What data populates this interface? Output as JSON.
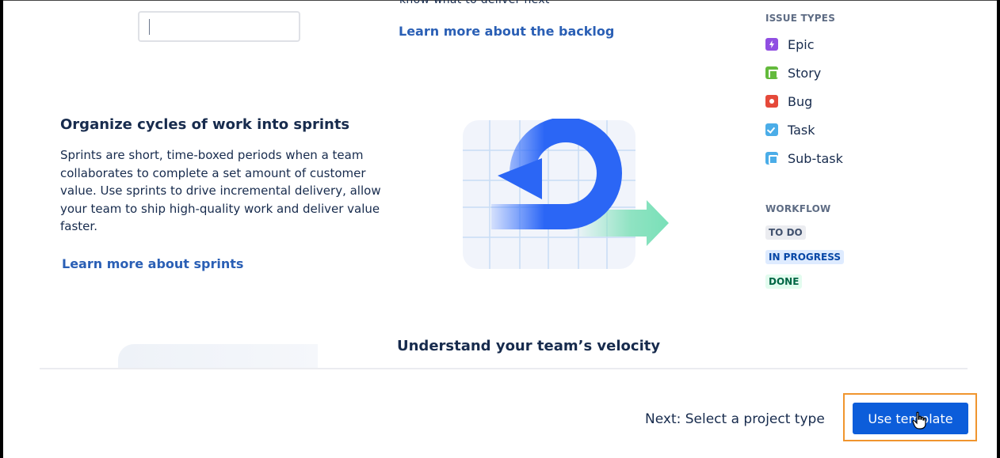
{
  "top": {
    "clipped_text": "know what to deliver next",
    "backlog_link": "Learn more about the backlog"
  },
  "issue_types": {
    "title": "ISSUE TYPES",
    "items": [
      {
        "label": "Epic",
        "icon": "epic-icon",
        "color": "#904ee2"
      },
      {
        "label": "Story",
        "icon": "story-icon",
        "color": "#63ba3c"
      },
      {
        "label": "Bug",
        "icon": "bug-icon",
        "color": "#e5493a"
      },
      {
        "label": "Task",
        "icon": "task-icon",
        "color": "#4bade8"
      },
      {
        "label": "Sub-task",
        "icon": "subtask-icon",
        "color": "#4bade8"
      }
    ]
  },
  "workflow": {
    "title": "WORKFLOW",
    "statuses": [
      {
        "label": "TO DO",
        "color": "#42526e"
      },
      {
        "label": "IN PROGRESS",
        "color": "#0747a6"
      },
      {
        "label": "DONE",
        "color": "#006644"
      }
    ]
  },
  "sprints_section": {
    "title": "Organize cycles of work into sprints",
    "body": "Sprints are short, time-boxed periods when a team collaborates to complete a set amount of customer value. Use sprints to drive incremental delivery, allow your team to ship high-quality work and deliver value faster.",
    "link": "Learn more about sprints",
    "illustration": "sprint-cycle-illustration"
  },
  "velocity_section": {
    "title": "Understand your team’s velocity"
  },
  "footer": {
    "next_label": "Next: Select a project type",
    "use_template_label": "Use template"
  },
  "colors": {
    "link": "#2a5fb5",
    "primary_button": "#0c5dda",
    "highlight": "#f0952e"
  }
}
